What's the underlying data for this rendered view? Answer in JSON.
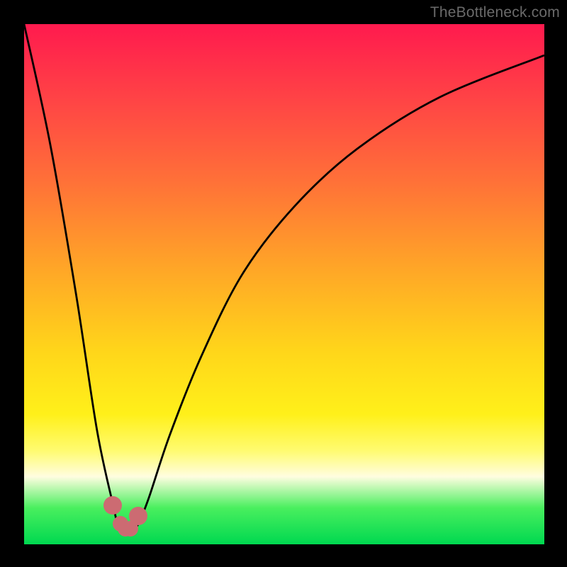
{
  "watermark": "TheBottleneck.com",
  "chart_data": {
    "type": "line",
    "title": "",
    "xlabel": "",
    "ylabel": "",
    "xlim": [
      0,
      100
    ],
    "ylim": [
      0,
      100
    ],
    "grid": false,
    "series": [
      {
        "name": "curve",
        "x": [
          0,
          5,
          10,
          14,
          17,
          18,
          19,
          20,
          21,
          22,
          24,
          28,
          34,
          42,
          52,
          64,
          80,
          100
        ],
        "values": [
          100,
          77,
          48,
          22,
          8,
          4,
          3,
          3,
          3,
          4,
          9,
          21,
          36,
          52,
          65,
          76,
          86,
          94
        ]
      }
    ],
    "markers": [
      {
        "x": 17.0,
        "y": 7.5,
        "size": "big"
      },
      {
        "x": 18.5,
        "y": 4.0,
        "size": "normal"
      },
      {
        "x": 19.5,
        "y": 3.0,
        "size": "normal"
      },
      {
        "x": 20.5,
        "y": 3.0,
        "size": "normal"
      },
      {
        "x": 22.0,
        "y": 5.5,
        "size": "big"
      }
    ],
    "colors": {
      "curve": "#000000",
      "marker": "#cc6b72",
      "gradient_top": "#ff1a4e",
      "gradient_bottom": "#00d850"
    }
  }
}
